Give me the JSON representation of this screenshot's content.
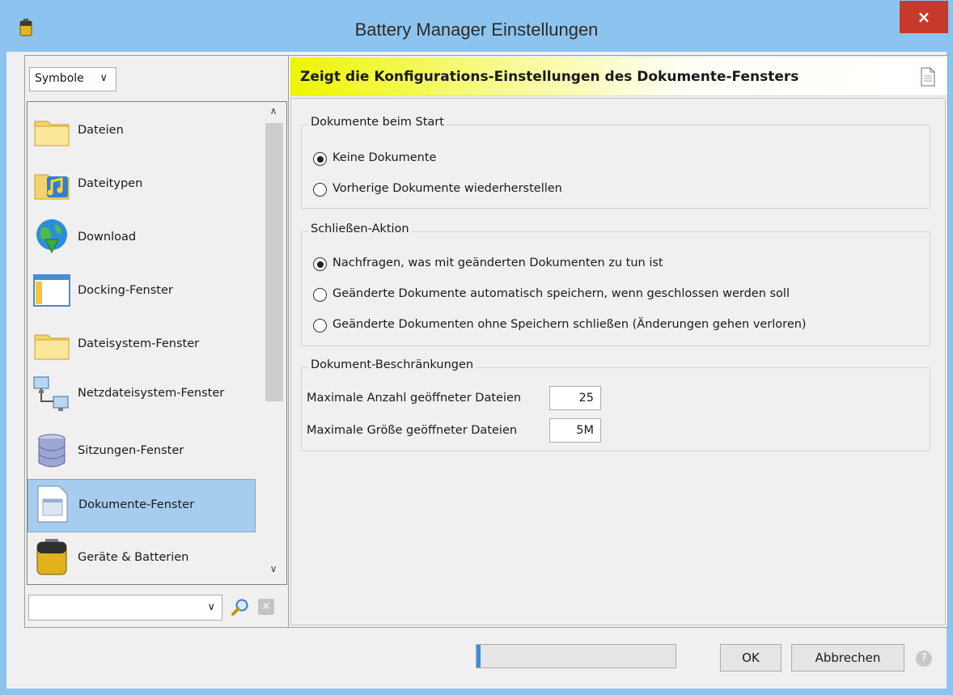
{
  "window": {
    "title": "Battery Manager Einstellungen",
    "close_glyph": "×",
    "app_icon": "battery-icon"
  },
  "sidebar": {
    "view_select": {
      "value": "Symbole",
      "chevron": "∨"
    },
    "items": [
      {
        "label": "Dateien",
        "icon": "folder-icon"
      },
      {
        "label": "Dateitypen",
        "icon": "music-folder-icon"
      },
      {
        "label": "Download",
        "icon": "globe-download-icon"
      },
      {
        "label": "Docking-Fenster",
        "icon": "docking-window-icon"
      },
      {
        "label": "Dateisystem-Fenster",
        "icon": "folder-icon"
      },
      {
        "label": "Netzdateisystem-Fenster",
        "icon": "network-computers-icon"
      },
      {
        "label": "Sitzungen-Fenster",
        "icon": "database-icon"
      },
      {
        "label": "Dokumente-Fenster",
        "icon": "document-window-icon"
      },
      {
        "label": "Geräte & Batterien",
        "icon": "battery-icon"
      }
    ],
    "selected_index": 7,
    "scroll_up": "∧",
    "scroll_down": "∨",
    "search": {
      "value": "",
      "chevron": "∨"
    },
    "clear_glyph": "×"
  },
  "panel": {
    "header": "Zeigt die Konfigurations-Einstellungen des Dokumente-Fensters",
    "groups": {
      "start": {
        "title": "Dokumente beim Start",
        "options": [
          {
            "label": "Keine Dokumente",
            "checked": true
          },
          {
            "label": "Vorherige Dokumente wiederherstellen",
            "checked": false
          }
        ]
      },
      "close": {
        "title": "Schließen-Aktion",
        "options": [
          {
            "label": "Nachfragen, was mit geänderten Dokumenten zu tun ist",
            "checked": true
          },
          {
            "label": "Geänderte Dokumente automatisch speichern, wenn geschlossen werden soll",
            "checked": false
          },
          {
            "label": "Geänderte Dokumenten ohne Speichern schließen (Änderungen gehen verloren)",
            "checked": false
          }
        ]
      },
      "limits": {
        "title": "Dokument-Beschränkungen",
        "max_count": {
          "label": "Maximale Anzahl geöffneter Dateien",
          "value": "25"
        },
        "max_size": {
          "label": "Maximale Größe geöffneter Dateien",
          "value": "5M"
        }
      }
    }
  },
  "footer": {
    "progress_fraction": 0.01,
    "ok_label": "OK",
    "cancel_label": "Abbrechen",
    "help_glyph": "?"
  },
  "colors": {
    "title_bar": "#8cc4ef",
    "close_button": "#c73a2b",
    "selection": "#a6cdee",
    "header_accent": "#eef500"
  }
}
